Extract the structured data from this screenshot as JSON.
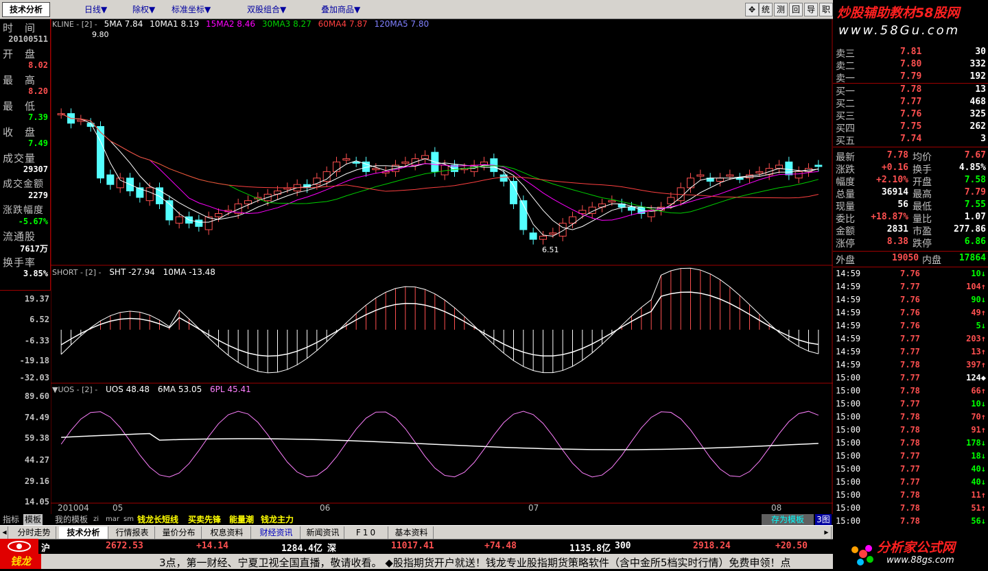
{
  "toolbar": {
    "active_tab": "技术分析",
    "menus": [
      "日线▼",
      "除权▼",
      "标准坐标▼",
      "双股组合▼",
      "叠加商品▼"
    ],
    "right_buttons": [
      "统",
      "测",
      "回",
      "导",
      "职"
    ]
  },
  "logo": {
    "line1": "炒股辅助教材58股网",
    "line2": "www.58Gu.com"
  },
  "info": {
    "time_label": "时　间",
    "date": "20100511",
    "open_label": "开　盘",
    "open": "8.02",
    "high_label": "最　高",
    "high": "8.20",
    "low_label": "最　低",
    "low": "7.39",
    "close_label": "收　盘",
    "close": "7.49",
    "volume_label": "成交量",
    "volume": "29307",
    "amount_label": "成交金额",
    "amount": "2279",
    "change_label": "涨跌幅度",
    "change": "-5.67%",
    "float_label": "流通股",
    "float": "7617万",
    "turnover_label": "换手率",
    "turnover": "3.85%"
  },
  "axis": [
    "19.37",
    "6.52",
    "-6.33",
    "-19.18",
    "-32.03",
    "89.60",
    "74.49",
    "59.38",
    "44.27",
    "29.16",
    "14.05"
  ],
  "indicators": {
    "kline": {
      "name": "KLINE - [2] -",
      "ma5": "5MA 7.84",
      "ma10": "10MA1 8.19",
      "ma15": "15MA2 8.46",
      "ma30": "30MA3 8.27",
      "ma60": "60MA4 7.87",
      "ma120": "120MA5 7.80"
    },
    "short": {
      "name": "SHORT - [2] -",
      "sht": "SHT -27.94",
      "ma": "10MA -13.48"
    },
    "uos": {
      "name": "▼UOS - [2] -",
      "uos": "UOS 48.48",
      "ma": "6MA 53.05",
      "pl": "6PL 45.41"
    },
    "peak_label": "9.80",
    "trough_label": "6.51"
  },
  "dates": [
    "201004",
    "05",
    "06",
    "07",
    "08"
  ],
  "colors": {
    "up": "#ff5050",
    "down": "#54ffff",
    "green": "#00ff00",
    "yellow": "#ffff00",
    "ma15": "#ff00ff",
    "ma30": "#00d000",
    "ma60": "#ff4040",
    "ma120": "#8080ff"
  },
  "quotes": {
    "asks": [
      {
        "label": "卖三",
        "price": "7.81",
        "vol": "30"
      },
      {
        "label": "卖二",
        "price": "7.80",
        "vol": "332"
      },
      {
        "label": "卖一",
        "price": "7.79",
        "vol": "192"
      }
    ],
    "bids": [
      {
        "label": "买一",
        "price": "7.78",
        "vol": "13"
      },
      {
        "label": "买二",
        "price": "7.77",
        "vol": "468"
      },
      {
        "label": "买三",
        "price": "7.76",
        "vol": "325"
      },
      {
        "label": "买四",
        "price": "7.75",
        "vol": "262"
      },
      {
        "label": "买五",
        "price": "7.74",
        "vol": "3"
      }
    ],
    "stats": [
      {
        "l1": "最新",
        "v1": "7.78",
        "l2": "均价",
        "v2": "7.67",
        "c1": "#ff5050",
        "c2": "#ff5050"
      },
      {
        "l1": "涨跌",
        "v1": "+0.16",
        "l2": "换手",
        "v2": "4.85%",
        "c1": "#ff5050",
        "c2": "#fff"
      },
      {
        "l1": "幅度",
        "v1": "+2.10%",
        "l2": "开盘",
        "v2": "7.58",
        "c1": "#ff5050",
        "c2": "#00ff00"
      },
      {
        "l1": "总量",
        "v1": "36914",
        "l2": "最高",
        "v2": "7.79",
        "c1": "#fff",
        "c2": "#ff5050"
      },
      {
        "l1": "现量",
        "v1": "56",
        "l2": "最低",
        "v2": "7.55",
        "c1": "#fff",
        "c2": "#00ff00"
      },
      {
        "l1": "委比",
        "v1": "+18.87%",
        "l2": "量比",
        "v2": "1.07",
        "c1": "#ff5050",
        "c2": "#fff"
      },
      {
        "l1": "金额",
        "v1": "2831",
        "l2": "市盈",
        "v2": "277.86",
        "c1": "#fff",
        "c2": "#fff"
      },
      {
        "l1": "涨停",
        "v1": "8.38",
        "l2": "跌停",
        "v2": "6.86",
        "c1": "#ff5050",
        "c2": "#00ff00"
      }
    ],
    "outer": {
      "l1": "外盘",
      "v1": "19050",
      "l2": "内盘",
      "v2": "17864"
    }
  },
  "ticks": [
    {
      "t": "14:59",
      "p": "7.76",
      "v": "10↓",
      "d": "down"
    },
    {
      "t": "14:59",
      "p": "7.77",
      "v": "104↑",
      "d": "up"
    },
    {
      "t": "14:59",
      "p": "7.76",
      "v": "90↓",
      "d": "down"
    },
    {
      "t": "14:59",
      "p": "7.76",
      "v": "49↑",
      "d": "up"
    },
    {
      "t": "14:59",
      "p": "7.76",
      "v": "5↓",
      "d": "down"
    },
    {
      "t": "14:59",
      "p": "7.77",
      "v": "203↑",
      "d": "up"
    },
    {
      "t": "14:59",
      "p": "7.77",
      "v": "13↑",
      "d": "up"
    },
    {
      "t": "14:59",
      "p": "7.78",
      "v": "397↑",
      "d": "up"
    },
    {
      "t": "15:00",
      "p": "7.77",
      "v": "124◆",
      "d": "none"
    },
    {
      "t": "15:00",
      "p": "7.78",
      "v": "66↑",
      "d": "up"
    },
    {
      "t": "15:00",
      "p": "7.77",
      "v": "10↓",
      "d": "down"
    },
    {
      "t": "15:00",
      "p": "7.78",
      "v": "70↑",
      "d": "up"
    },
    {
      "t": "15:00",
      "p": "7.78",
      "v": "91↑",
      "d": "up"
    },
    {
      "t": "15:00",
      "p": "7.78",
      "v": "178↓",
      "d": "down"
    },
    {
      "t": "15:00",
      "p": "7.77",
      "v": "18↓",
      "d": "down"
    },
    {
      "t": "15:00",
      "p": "7.77",
      "v": "40↓",
      "d": "down"
    },
    {
      "t": "15:00",
      "p": "7.77",
      "v": "40↓",
      "d": "down"
    },
    {
      "t": "15:00",
      "p": "7.78",
      "v": "11↑",
      "d": "up"
    },
    {
      "t": "15:00",
      "p": "7.78",
      "v": "51↑",
      "d": "up"
    },
    {
      "t": "15:00",
      "p": "7.78",
      "v": "56↓",
      "d": "down"
    }
  ],
  "bottomtabs": [
    "指标",
    "模板",
    "我的模板",
    "zi",
    "mar",
    "sm",
    "钱龙长短线",
    "买卖先锋",
    "能量潮",
    "钱龙主力",
    "存为模板",
    "3图"
  ],
  "navtabs": [
    "分时走势",
    "技术分析",
    "行情报表",
    "量价分布",
    "权息资料",
    "财经资讯",
    "新闻资讯",
    "F10",
    "基本资料"
  ],
  "status": {
    "sh_label": "沪",
    "sh_idx": "2672.53",
    "sh_chg": "+14.14",
    "sh_amt": "1284.4亿",
    "sz_label": "深",
    "sz_idx": "11017.41",
    "sz_chg": "+74.48",
    "sz_amt": "1135.8亿",
    "s3_label": "300",
    "s3_idx": "2918.24",
    "s3_chg": "+20.50"
  },
  "ticker": "3点，第一财经、宁夏卫视全国直播，敬请收看。  ◆股指期货开户就送！钱龙专业股指期货策略软件（含中金所5档实时行情）免费申领！点",
  "brand_left": "钱龙",
  "brand_right": {
    "name": "分析家公式网",
    "url": "www.88gs.com"
  }
}
